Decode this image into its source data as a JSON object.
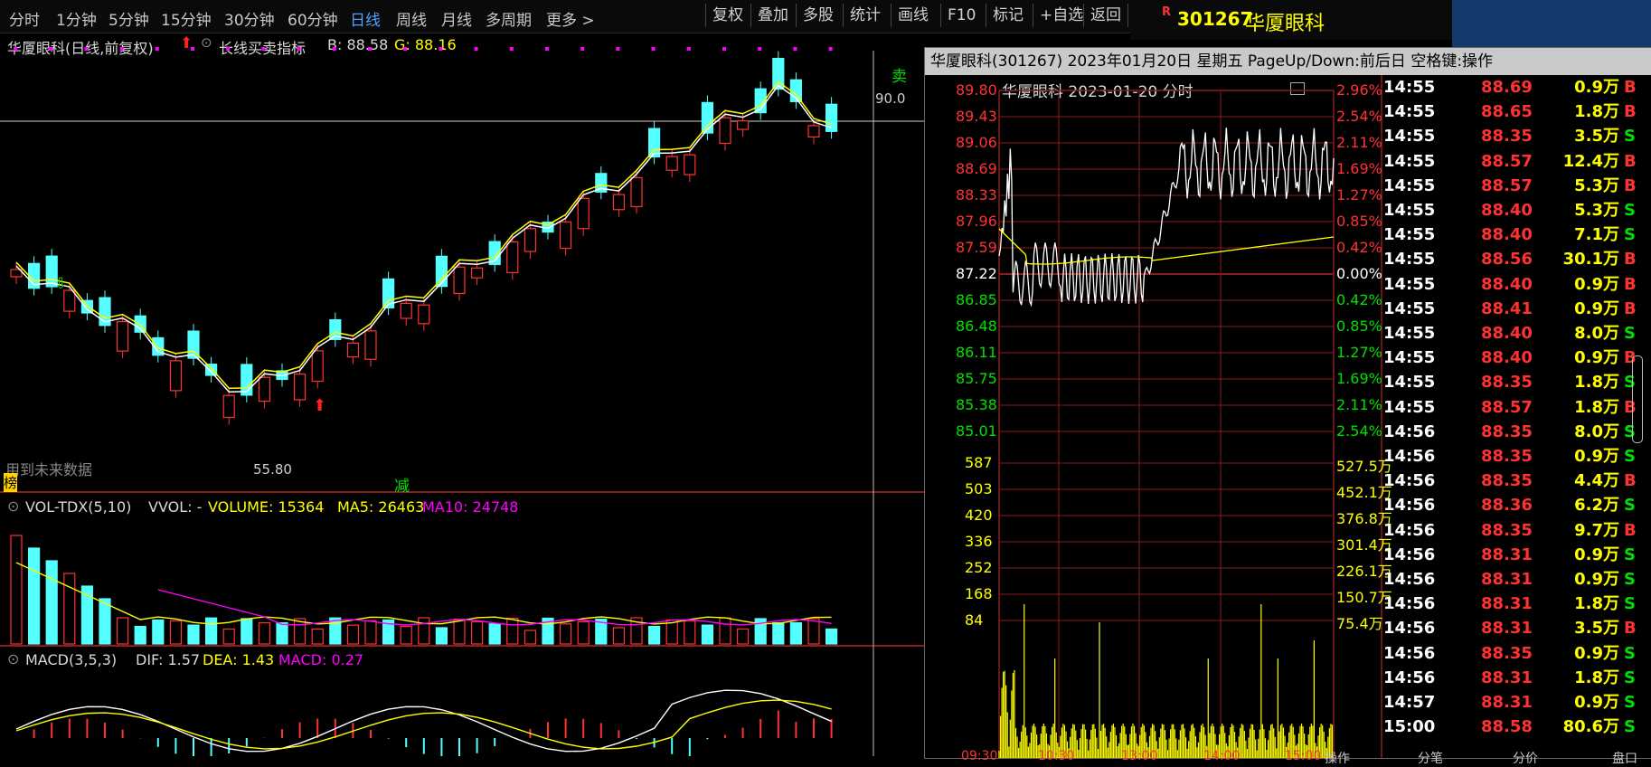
{
  "toolbar": {
    "periods": [
      "分时",
      "1分钟",
      "5分钟",
      "15分钟",
      "30分钟",
      "60分钟",
      "日线",
      "周线",
      "月线",
      "多周期",
      "更多 >"
    ],
    "buttons": [
      "复权",
      "叠加",
      "多股",
      "统计",
      "画线",
      "F10",
      "标记",
      "+自选",
      "返回"
    ]
  },
  "stock": {
    "badge": "R",
    "code": "301267",
    "name": "华厦眼科"
  },
  "main": {
    "title": "华厦眼科(日线,前复权)",
    "indicator": "长线买卖指标",
    "b_label": "B: 88.58",
    "g_label": "G: 88.16",
    "high_label": "90.0",
    "low_label": "55.80",
    "sell_marker": "卖",
    "reduce_marker": "减",
    "future_note": "用到未来数据",
    "bang": "榜"
  },
  "volume_panel": {
    "name": "VOL-TDX(5,10)",
    "wvol": "VVOL: -",
    "volume": "VOLUME: 15364",
    "ma5": "MA5: 26463",
    "ma10": "MA10: 24748"
  },
  "macd_panel": {
    "name": "MACD(3,5,3)",
    "dif": "DIF: 1.57",
    "dea": "DEA: 1.43",
    "macd": "MACD: 0.27"
  },
  "intraday": {
    "title": "华厦眼科(301267) 2023年01月20日 星期五 PageUp/Down:前后日 空格键:操作",
    "mini_title": "华厦眼科  2023-01-20 分时",
    "price_labels": [
      "89.80",
      "89.43",
      "89.06",
      "88.69",
      "88.33",
      "87.96",
      "87.59",
      "87.22",
      "86.85",
      "86.48",
      "86.11",
      "85.75",
      "85.38",
      "85.01"
    ],
    "pct_labels": [
      "2.96%",
      "2.54%",
      "2.11%",
      "1.69%",
      "1.27%",
      "0.85%",
      "0.42%",
      "0.00%",
      "0.42%",
      "0.85%",
      "1.27%",
      "1.69%",
      "2.11%",
      "2.54%"
    ],
    "vol_left": [
      "587",
      "503",
      "420",
      "336",
      "252",
      "168",
      "84"
    ],
    "vol_right": [
      "527.5万",
      "452.1万",
      "376.8万",
      "301.4万",
      "226.1万",
      "150.7万",
      "75.4万"
    ],
    "time_labels": [
      "09:30",
      "10:30",
      "13:00",
      "14:00",
      "15:00"
    ],
    "op_label": "操作"
  },
  "ticks": [
    {
      "t": "14:55",
      "p": "88.69",
      "v": "0.9万",
      "d": "B"
    },
    {
      "t": "14:55",
      "p": "88.65",
      "v": "1.8万",
      "d": "B"
    },
    {
      "t": "14:55",
      "p": "88.35",
      "v": "3.5万",
      "d": "S"
    },
    {
      "t": "14:55",
      "p": "88.57",
      "v": "12.4万",
      "d": "B"
    },
    {
      "t": "14:55",
      "p": "88.57",
      "v": "5.3万",
      "d": "B"
    },
    {
      "t": "14:55",
      "p": "88.40",
      "v": "5.3万",
      "d": "S"
    },
    {
      "t": "14:55",
      "p": "88.40",
      "v": "7.1万",
      "d": "S"
    },
    {
      "t": "14:55",
      "p": "88.56",
      "v": "30.1万",
      "d": "B"
    },
    {
      "t": "14:55",
      "p": "88.40",
      "v": "0.9万",
      "d": "B"
    },
    {
      "t": "14:55",
      "p": "88.41",
      "v": "0.9万",
      "d": "B"
    },
    {
      "t": "14:55",
      "p": "88.40",
      "v": "8.0万",
      "d": "S"
    },
    {
      "t": "14:55",
      "p": "88.40",
      "v": "0.9万",
      "d": "B"
    },
    {
      "t": "14:55",
      "p": "88.35",
      "v": "1.8万",
      "d": "S"
    },
    {
      "t": "14:55",
      "p": "88.57",
      "v": "1.8万",
      "d": "B"
    },
    {
      "t": "14:56",
      "p": "88.35",
      "v": "8.0万",
      "d": "S"
    },
    {
      "t": "14:56",
      "p": "88.35",
      "v": "0.9万",
      "d": "S"
    },
    {
      "t": "14:56",
      "p": "88.35",
      "v": "4.4万",
      "d": "B"
    },
    {
      "t": "14:56",
      "p": "88.36",
      "v": "6.2万",
      "d": "S"
    },
    {
      "t": "14:56",
      "p": "88.35",
      "v": "9.7万",
      "d": "B"
    },
    {
      "t": "14:56",
      "p": "88.31",
      "v": "0.9万",
      "d": "S"
    },
    {
      "t": "14:56",
      "p": "88.31",
      "v": "0.9万",
      "d": "S"
    },
    {
      "t": "14:56",
      "p": "88.31",
      "v": "1.8万",
      "d": "S"
    },
    {
      "t": "14:56",
      "p": "88.31",
      "v": "3.5万",
      "d": "B"
    },
    {
      "t": "14:56",
      "p": "88.35",
      "v": "0.9万",
      "d": "S"
    },
    {
      "t": "14:56",
      "p": "88.31",
      "v": "1.8万",
      "d": "S"
    },
    {
      "t": "14:57",
      "p": "88.31",
      "v": "0.9万",
      "d": "S"
    },
    {
      "t": "15:00",
      "p": "88.58",
      "v": "80.6万",
      "d": "S"
    }
  ],
  "tick_footer": [
    "分笔",
    "分价",
    "盘口"
  ],
  "colors": {
    "up": "#ff3232",
    "down": "#54ffff",
    "ma_yellow": "#ffff00",
    "ma_magenta": "#ff00ff",
    "grid": "#8a1c1c",
    "price_yellow": "#ffff00",
    "tick_time": "#ffffff",
    "buy": "#ff3232",
    "sell": "#00e000"
  }
}
